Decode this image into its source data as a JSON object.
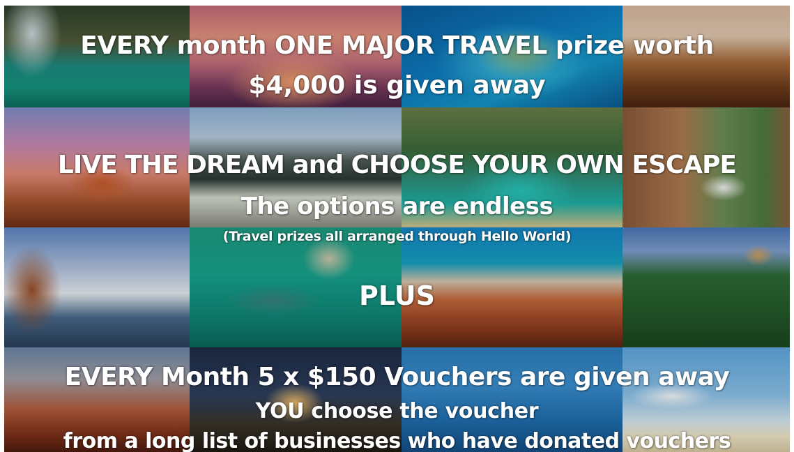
{
  "headline": {
    "line1": "EVERY month ONE MAJOR TRAVEL prize worth",
    "line2": "$4,000 is given away"
  },
  "escape": {
    "title": "LIVE THE DREAM and CHOOSE  YOUR OWN ESCAPE",
    "subtitle": "The options are endless",
    "note": "(Travel prizes all arranged through Hello World)"
  },
  "plus_label": "PLUS",
  "vouchers": {
    "title": "EVERY Month  5 x $150 Vouchers are given away",
    "line1": "YOU choose the voucher",
    "line2": "from a long list of businesses who have donated vouchers"
  },
  "colors": {
    "text": "#ffffff"
  }
}
